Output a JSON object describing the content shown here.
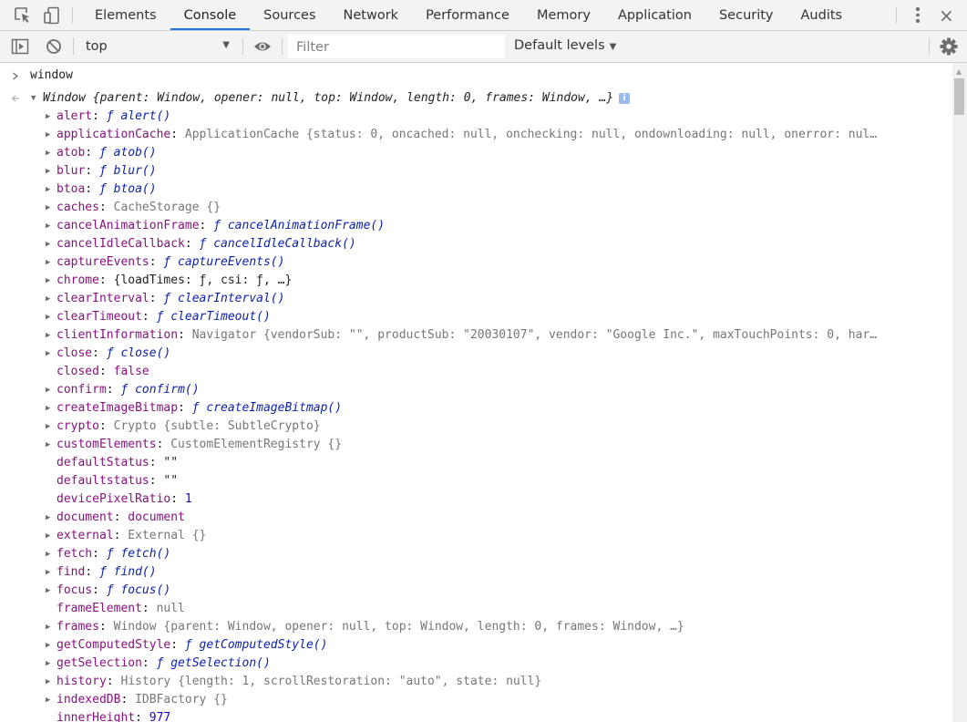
{
  "tabs": [
    "Elements",
    "Console",
    "Sources",
    "Network",
    "Performance",
    "Memory",
    "Application",
    "Security",
    "Audits"
  ],
  "active_tab": "Console",
  "accent_color": "#1a73e8",
  "icons": {
    "inspect": "cursor-inspect-icon",
    "device": "device-toggle-icon",
    "more": "kebab-menu-icon",
    "close": "close-icon",
    "sidebar": "sidebar-toggle-icon",
    "clear": "clear-console-icon",
    "eye": "eye-icon",
    "settings": "gear-icon"
  },
  "toolbar": {
    "context": "top",
    "filter_placeholder": "Filter",
    "levels": "Default levels",
    "close_glyph": "×"
  },
  "console": {
    "command": "window",
    "result_header": "Window {parent: Window, opener: null, top: Window, length: 0, frames: Window, …}",
    "info_badge": "i",
    "props": [
      {
        "expandable": true,
        "name": "alert",
        "value": "ƒ alert()",
        "type": "func"
      },
      {
        "expandable": true,
        "name": "applicationCache",
        "value": "ApplicationCache {status: 0, oncached: null, onchecking: null, ondownloading: null, onerror: nul…",
        "type": "obj"
      },
      {
        "expandable": true,
        "name": "atob",
        "value": "ƒ atob()",
        "type": "func"
      },
      {
        "expandable": true,
        "name": "blur",
        "value": "ƒ blur()",
        "type": "func"
      },
      {
        "expandable": true,
        "name": "btoa",
        "value": "ƒ btoa()",
        "type": "func"
      },
      {
        "expandable": true,
        "name": "caches",
        "value": "CacheStorage {}",
        "type": "obj"
      },
      {
        "expandable": true,
        "name": "cancelAnimationFrame",
        "value": "ƒ cancelAnimationFrame()",
        "type": "func"
      },
      {
        "expandable": true,
        "name": "cancelIdleCallback",
        "value": "ƒ cancelIdleCallback()",
        "type": "func"
      },
      {
        "expandable": true,
        "name": "captureEvents",
        "value": "ƒ captureEvents()",
        "type": "func"
      },
      {
        "expandable": true,
        "name": "chrome",
        "value": "{loadTimes: ƒ, csi: ƒ, …}",
        "type": "plain"
      },
      {
        "expandable": true,
        "name": "clearInterval",
        "value": "ƒ clearInterval()",
        "type": "func"
      },
      {
        "expandable": true,
        "name": "clearTimeout",
        "value": "ƒ clearTimeout()",
        "type": "func"
      },
      {
        "expandable": true,
        "name": "clientInformation",
        "value": "Navigator {vendorSub: \"\", productSub: \"20030107\", vendor: \"Google Inc.\", maxTouchPoints: 0, har…",
        "type": "obj"
      },
      {
        "expandable": true,
        "name": "close",
        "value": "ƒ close()",
        "type": "func"
      },
      {
        "expandable": false,
        "name": "closed",
        "value": "false",
        "type": "kw"
      },
      {
        "expandable": true,
        "name": "confirm",
        "value": "ƒ confirm()",
        "type": "func"
      },
      {
        "expandable": true,
        "name": "createImageBitmap",
        "value": "ƒ createImageBitmap()",
        "type": "func"
      },
      {
        "expandable": true,
        "name": "crypto",
        "value": "Crypto {subtle: SubtleCrypto}",
        "type": "obj"
      },
      {
        "expandable": true,
        "name": "customElements",
        "value": "CustomElementRegistry {}",
        "type": "obj"
      },
      {
        "expandable": false,
        "name": "defaultStatus",
        "value": "\"\"",
        "type": "plain"
      },
      {
        "expandable": false,
        "name": "defaultstatus",
        "value": "\"\"",
        "type": "plain"
      },
      {
        "expandable": false,
        "name": "devicePixelRatio",
        "value": "1",
        "type": "num"
      },
      {
        "expandable": true,
        "name": "document",
        "value": "document",
        "type": "kw"
      },
      {
        "expandable": true,
        "name": "external",
        "value": "External {}",
        "type": "obj"
      },
      {
        "expandable": true,
        "name": "fetch",
        "value": "ƒ fetch()",
        "type": "func"
      },
      {
        "expandable": true,
        "name": "find",
        "value": "ƒ find()",
        "type": "func"
      },
      {
        "expandable": true,
        "name": "focus",
        "value": "ƒ focus()",
        "type": "func"
      },
      {
        "expandable": false,
        "name": "frameElement",
        "value": "null",
        "type": "null"
      },
      {
        "expandable": true,
        "name": "frames",
        "value": "Window {parent: Window, opener: null, top: Window, length: 0, frames: Window, …}",
        "type": "obj"
      },
      {
        "expandable": true,
        "name": "getComputedStyle",
        "value": "ƒ getComputedStyle()",
        "type": "func"
      },
      {
        "expandable": true,
        "name": "getSelection",
        "value": "ƒ getSelection()",
        "type": "func"
      },
      {
        "expandable": true,
        "name": "history",
        "value": "History {length: 1, scrollRestoration: \"auto\", state: null}",
        "type": "obj"
      },
      {
        "expandable": true,
        "name": "indexedDB",
        "value": "IDBFactory {}",
        "type": "obj"
      },
      {
        "expandable": false,
        "name": "innerHeight",
        "value": "977",
        "type": "num"
      }
    ]
  }
}
